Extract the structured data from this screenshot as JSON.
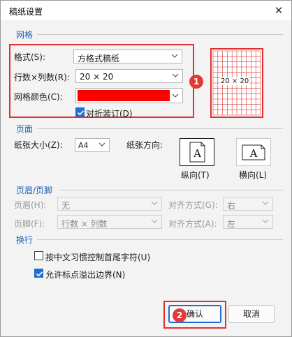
{
  "dialog": {
    "title": "稿纸设置",
    "close_icon": "close-icon"
  },
  "grid_section": {
    "title": "网格",
    "format_label": "格式(S):",
    "format_value": "方格式稿纸",
    "rowcol_label": "行数×列数(R):",
    "rowcol_value": "20 × 20",
    "color_label": "网格颜色(C):",
    "color_value": "#ff0000",
    "fold_label": "对折装订(D)",
    "fold_checked": true,
    "preview_text": "20 × 20",
    "badge": "1"
  },
  "page_section": {
    "title": "页面",
    "size_label": "纸张大小(Z):",
    "size_value": "A4",
    "orientation_label": "纸张方向:",
    "portrait_label": "纵向(T)",
    "landscape_label": "横向(L)",
    "glyph": "A"
  },
  "header_footer_section": {
    "title": "页眉/页脚",
    "header_label": "页眉(H):",
    "header_value": "无",
    "header_align_label": "对齐方式(G):",
    "header_align_value": "右",
    "footer_label": "页脚(F):",
    "footer_value": "行数 × 列数",
    "footer_align_label": "对齐方式(A):",
    "footer_align_value": "左"
  },
  "wrap_section": {
    "title": "换行",
    "option1_label": "按中文习惯控制首尾字符(U)",
    "option1_checked": false,
    "option2_label": "允许标点溢出边界(N)",
    "option2_checked": true
  },
  "buttons": {
    "ok_label": "确认",
    "cancel_label": "取消",
    "badge": "2"
  },
  "colors": {
    "accent": "#1f6fd0",
    "section_title": "#1f5eb8",
    "highlight_red": "#e03030",
    "badge_red": "#e53935"
  }
}
